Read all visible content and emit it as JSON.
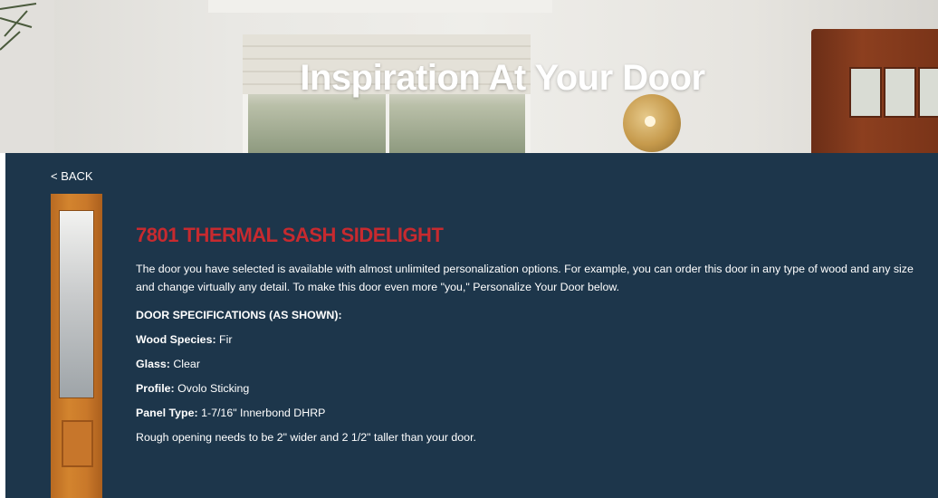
{
  "hero": {
    "title": "Inspiration At Your Door"
  },
  "nav": {
    "back_label": "< BACK"
  },
  "product": {
    "name": "7801 THERMAL SASH SIDELIGHT",
    "description": "The door you have selected is available with almost unlimited personalization options. For example, you can order this door in any type of wood and any size and change virtually any detail. To make this door even more \"you,\" Personalize Your Door below.",
    "specs_heading": "DOOR SPECIFICATIONS (AS SHOWN):",
    "specs": [
      {
        "label": "Wood Species:",
        "value": " Fir"
      },
      {
        "label": "Glass:",
        "value": " Clear"
      },
      {
        "label": "Profile:",
        "value": " Ovolo Sticking"
      },
      {
        "label": "Panel Type:",
        "value": " 1-7/16\" Innerbond DHRP"
      }
    ],
    "rough_opening_note": "Rough opening needs to be 2\" wider and 2 1/2\" taller than your door."
  },
  "colors": {
    "content_background": "#1d364b",
    "title_red": "#c72a2f",
    "door_wood": "#d3842e"
  }
}
